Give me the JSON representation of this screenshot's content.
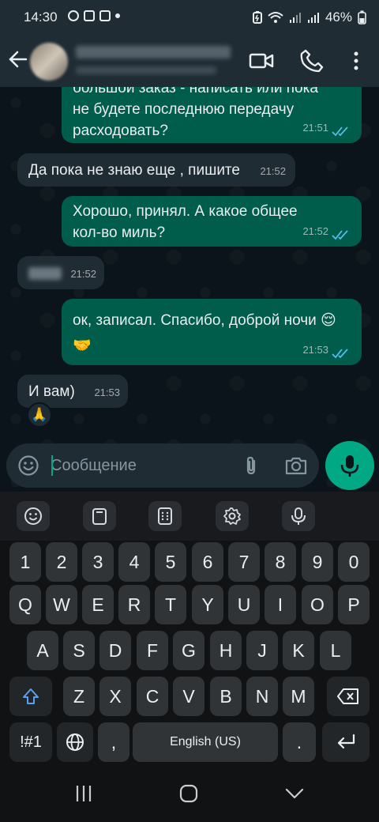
{
  "status_bar": {
    "time": "14:30",
    "battery": "46%"
  },
  "header": {
    "contact_name": "",
    "contact_status": ""
  },
  "messages": [
    {
      "dir": "out",
      "text": "большой заказ - написать или пока\nне будете последнюю передачу\nрасходовать?",
      "time": "21:51",
      "read": true
    },
    {
      "dir": "in",
      "text": "Да пока не знаю еще , пишите",
      "time": "21:52"
    },
    {
      "dir": "out",
      "text": "Хорошо, принял. А какое общее\nкол-во миль?",
      "time": "21:52",
      "read": true
    },
    {
      "dir": "in",
      "text": "",
      "blurred": true,
      "time": "21:52"
    },
    {
      "dir": "out",
      "text": "ок, записал. Спасибо, доброй ночи 😌\n🤝",
      "time": "21:53",
      "read": true
    },
    {
      "dir": "in",
      "text": "И вам)",
      "time": "21:53",
      "reaction": "🙏"
    }
  ],
  "composer": {
    "placeholder": "Сообщение"
  },
  "keyboard": {
    "toolbar": [
      "emoji-icon",
      "clipboard-icon",
      "keypad-icon",
      "settings-icon",
      "mic-icon"
    ],
    "rows": [
      [
        "1",
        "2",
        "3",
        "4",
        "5",
        "6",
        "7",
        "8",
        "9",
        "0"
      ],
      [
        "Q",
        "W",
        "E",
        "R",
        "T",
        "Y",
        "U",
        "I",
        "O",
        "P"
      ],
      [
        "A",
        "S",
        "D",
        "F",
        "G",
        "H",
        "J",
        "K",
        "L"
      ],
      [
        "Z",
        "X",
        "C",
        "V",
        "B",
        "N",
        "M"
      ]
    ],
    "symbols_key": "!#1",
    "comma_key": ",",
    "space_label": "English (US)",
    "period_key": "."
  },
  "colors": {
    "accent": "#00a884",
    "outgoing_bubble": "#005c4b",
    "incoming_bubble": "#202c33",
    "read_ticks": "#53bdeb"
  }
}
